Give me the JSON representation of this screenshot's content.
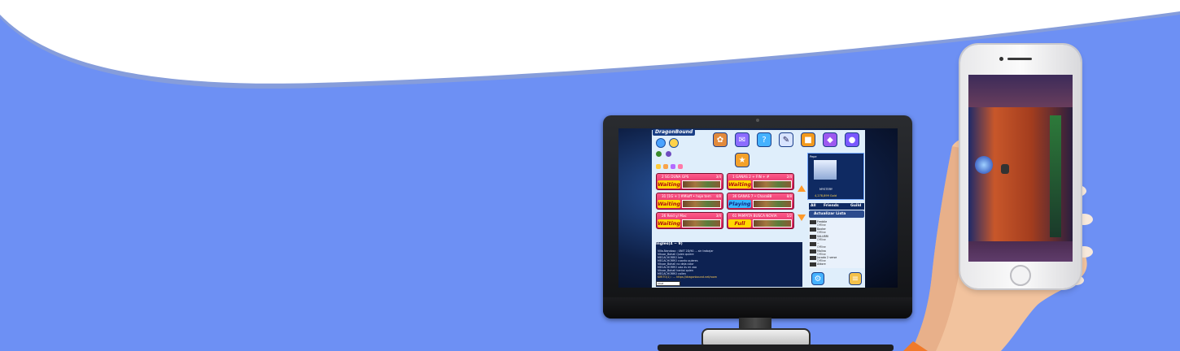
{
  "colors": {
    "background": "#6d90f4",
    "wave": "#ffffff",
    "room_red": "#e2245e",
    "status_waiting": "#ffd800",
    "status_playing": "#35b6ff"
  },
  "game": {
    "logo": "DragonBound",
    "top_icons": [
      "mushroom-icon",
      "mailbox-icon",
      "question-icon",
      "paper-icon",
      "gift-icon",
      "chest-icon",
      "potion-icon"
    ],
    "rooms": [
      {
        "title": "2  SG DUNA GPS",
        "count": "3/4",
        "status": "Waiting"
      },
      {
        "title": "1   GANAS 2 + FIN + #",
        "count": "2/4",
        "status": "Waiting"
      },
      {
        "title": "31  [1G + ] #Mioff • hoje tem",
        "count": "4/8",
        "status": "Waiting"
      },
      {
        "title": "36  GANAS 7 • Chara88",
        "count": "8/8",
        "status": "Playing"
      },
      {
        "title": "26  Reid y/ Mac",
        "count": "3/4",
        "status": "Waiting"
      },
      {
        "title": "61  PAMPITA BUSCA NOVIA",
        "count": "1/2",
        "status": "Full"
      }
    ],
    "chat": {
      "header": "Ingles(4 ~ 9)",
      "lines": [
        "Villa.Nandoso : UNIT 2D/90 ... sin trabajar",
        "Vikuar_Bohall  Quien quiere",
        "MECACHORRO  lulu",
        "MECACHORRO  cuanto quieres",
        "Vikuar_Bohall  no deja color",
        "MECACHORRO  uda es mi zoo",
        "Vikuar_Bohall  hentai quien",
        "MECACHORRO  callen",
        "KIRITO(1) : ... https://dragonbound.net/room"
      ],
      "input": "Chat"
    },
    "profile": {
      "name": "Pepe",
      "guild": "MYSTERY",
      "gold": "4,278,899 Gold"
    },
    "friends": {
      "tabs": [
        "All",
        "Friends",
        "Guild"
      ],
      "update": "Actualizar Lista",
      "list": [
        {
          "name": "Freddie",
          "status": "Offline"
        },
        {
          "name": "Baxter",
          "status": "Offline"
        },
        {
          "name": "SALUBRI",
          "status": "Offline"
        },
        {
          "name": "~",
          "status": "Offline"
        },
        {
          "name": "Malina",
          "status": "Offline"
        },
        {
          "name": "Jucado 2 verse",
          "status": "Offline"
        },
        {
          "name": "Aldore",
          "status": "Offline"
        },
        {
          "name": "RAYMOND",
          "status": "Offline"
        }
      ]
    }
  }
}
